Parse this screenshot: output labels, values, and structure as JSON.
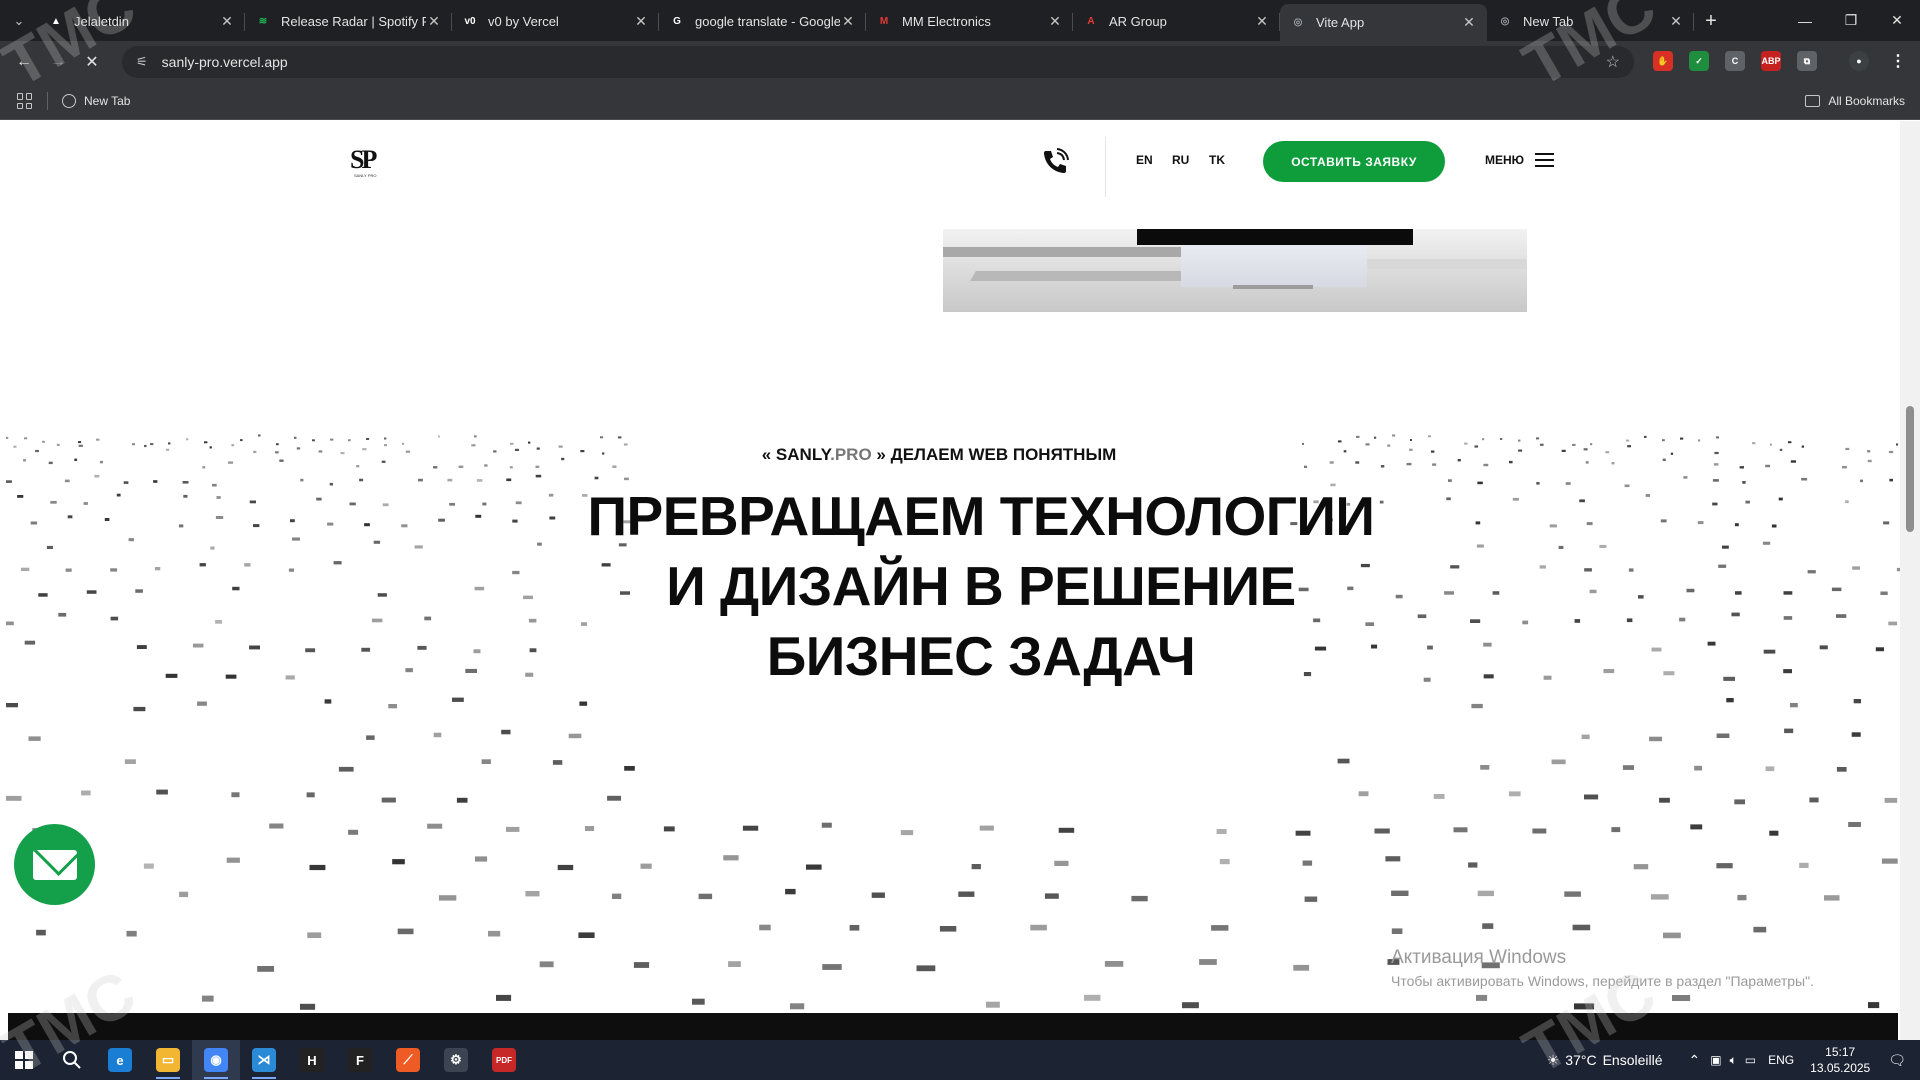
{
  "browser": {
    "tabs": [
      {
        "title": "Jelaletdin",
        "favicon_color": "#ffffff",
        "favicon_glyph": "▲",
        "active": false
      },
      {
        "title": "Release Radar | Spotify Pl",
        "favicon_color": "#1db954",
        "favicon_glyph": "≋",
        "active": false
      },
      {
        "title": "v0 by Vercel",
        "favicon_color": "#ffffff",
        "favicon_glyph": "v0",
        "active": false
      },
      {
        "title": "google translate - Google",
        "favicon_color": "#ffffff",
        "favicon_glyph": "G",
        "active": false
      },
      {
        "title": "MM Electronics",
        "favicon_color": "#e53935",
        "favicon_glyph": "M",
        "active": false
      },
      {
        "title": "AR Group",
        "favicon_color": "#e53935",
        "favicon_glyph": "A",
        "active": false
      },
      {
        "title": "Vite App",
        "favicon_color": "#9aa0a6",
        "favicon_glyph": "◎",
        "active": true
      },
      {
        "title": "New Tab",
        "favicon_color": "#9aa0a6",
        "favicon_glyph": "◎",
        "active": false
      }
    ],
    "url": "sanly-pro.vercel.app",
    "bookmarks": [
      {
        "label": "New Tab"
      }
    ],
    "all_bookmarks_label": "All Bookmarks",
    "extensions": [
      {
        "name": "red-hand-extension-icon",
        "color": "#d93025",
        "glyph": "✋"
      },
      {
        "name": "shield-extension-icon",
        "color": "#1e8e3e",
        "glyph": "✓"
      },
      {
        "name": "code-extension-icon",
        "color": "#5f6368",
        "glyph": "C"
      },
      {
        "name": "abp-extension-icon",
        "color": "#c5221f",
        "glyph": "ABP"
      },
      {
        "name": "puzzle-extension-icon",
        "color": "#5f6368",
        "glyph": "⧉"
      }
    ]
  },
  "site": {
    "logo_text": "SP",
    "logo_subtext": "SANLY PRO",
    "languages": [
      "EN",
      "RU",
      "TK"
    ],
    "cta_label": "ОСТАВИТЬ ЗАЯВКУ",
    "menu_label": "МЕНЮ",
    "hero_tag_prefix": "« SANLY",
    "hero_tag_dot": ".PRO",
    "hero_tag_suffix": "» ДЕЛАЕМ WEB ПОНЯТНЫМ",
    "hero_lines": [
      "ПРЕВРАЩАЕМ ТЕХНОЛОГИИ",
      "И ДИЗАЙН В РЕШЕНИЕ",
      "БИЗНЕС ЗАДАЧ"
    ],
    "accent_color": "#0f9d3c"
  },
  "windows_activation": {
    "title": "Активация Windows",
    "subtitle": "Чтобы активировать Windows, перейдите в раздел \"Параметры\"."
  },
  "taskbar": {
    "apps": [
      {
        "name": "edge-icon",
        "color": "#1a7fd4",
        "glyph": "e",
        "running": false,
        "active": false
      },
      {
        "name": "file-explorer-icon",
        "color": "#f2b632",
        "glyph": "▭",
        "running": true,
        "active": false
      },
      {
        "name": "chrome-icon",
        "color": "#4285f4",
        "glyph": "◉",
        "running": true,
        "active": true
      },
      {
        "name": "vscode-icon",
        "color": "#2b8ad6",
        "glyph": "⋊",
        "running": true,
        "active": false
      },
      {
        "name": "hyper-icon",
        "color": "#222222",
        "glyph": "H",
        "running": false,
        "active": false
      },
      {
        "name": "figma-icon",
        "color": "#222222",
        "glyph": "F",
        "running": false,
        "active": false
      },
      {
        "name": "postman-icon",
        "color": "#ef5b25",
        "glyph": "⟋",
        "running": false,
        "active": false
      },
      {
        "name": "settings-icon",
        "color": "#3c4452",
        "glyph": "⚙",
        "running": false,
        "active": false
      },
      {
        "name": "pdf-app-icon",
        "color": "#c62828",
        "glyph": "PDF",
        "running": false,
        "active": false
      }
    ],
    "weather_temp": "37°C",
    "weather_text": "Ensoleillé",
    "language": "ENG",
    "time": "15:17",
    "date": "13.05.2025"
  },
  "watermark_text": "TMC"
}
